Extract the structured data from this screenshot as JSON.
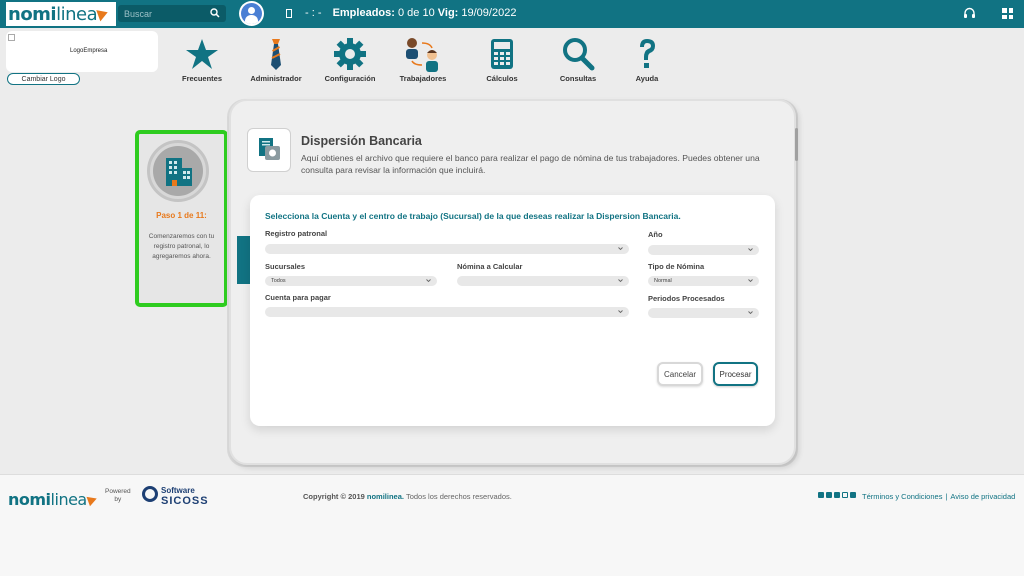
{
  "topbar": {
    "brand_bold": "nomi",
    "brand_light": "linea",
    "search_placeholder": "Buscar",
    "info_dash": "- : -",
    "employees_label": "Empleados:",
    "employees_value": "0 de 10",
    "vig_label": "Vig:",
    "vig_value": "19/09/2022",
    "accent_color": "#117383"
  },
  "logo": {
    "placeholder_text": "LogoEmpresa",
    "change_button": "Cambiar Logo"
  },
  "nav": [
    {
      "label": "Frecuentes",
      "icon": "star-icon"
    },
    {
      "label": "Administrador",
      "icon": "tie-icon"
    },
    {
      "label": "Configuración",
      "icon": "gear-icon"
    },
    {
      "label": "Trabajadores",
      "icon": "workers-icon"
    },
    {
      "label": "Cálculos",
      "icon": "calculator-icon"
    },
    {
      "label": "Consultas",
      "icon": "magnifier-icon"
    },
    {
      "label": "Ayuda",
      "icon": "question-icon"
    }
  ],
  "step": {
    "title": "Paso 1 de 11:",
    "text": "Comenzaremos con tu registro patronal, lo agregaremos ahora."
  },
  "page": {
    "title": "Dispersión Bancaria",
    "description": "Aquí obtienes el archivo que requiere el banco para realizar el pago de nómina de tus trabajadores. Puedes obtener una consulta para revisar la información que incluirá."
  },
  "form": {
    "heading": "Selecciona la Cuenta y el centro de trabajo (Sucursal) de la que deseas realizar la Dispersion Bancaria.",
    "registro_patronal": {
      "label": "Registro patronal",
      "value": ""
    },
    "anio": {
      "label": "Año",
      "value": ""
    },
    "sucursales": {
      "label": "Sucursales",
      "value": "Todos"
    },
    "nomina_calcular": {
      "label": "Nómina a Calcular",
      "value": ""
    },
    "tipo_nomina": {
      "label": "Tipo de Nómina",
      "value": "Normal"
    },
    "cuenta_pagar": {
      "label": "Cuenta para pagar",
      "value": ""
    },
    "periodos": {
      "label": "Periodos Procesados",
      "value": ""
    },
    "cancel_button": "Cancelar",
    "process_button": "Procesar"
  },
  "footer": {
    "brand_bold": "nomi",
    "brand_light": "linea",
    "powered_line1": "Powered",
    "powered_line2": "by",
    "sicoss_top": "Software",
    "sicoss_bottom": "SICOSS",
    "copyright_prefix": "Copyright © 2019",
    "copyright_brand": "nomilinea.",
    "copyright_suffix": "Todos los derechos reservados.",
    "terms_link": "Términos y Condiciones",
    "privacy_link": "Aviso de privacidad",
    "separator": "|"
  }
}
